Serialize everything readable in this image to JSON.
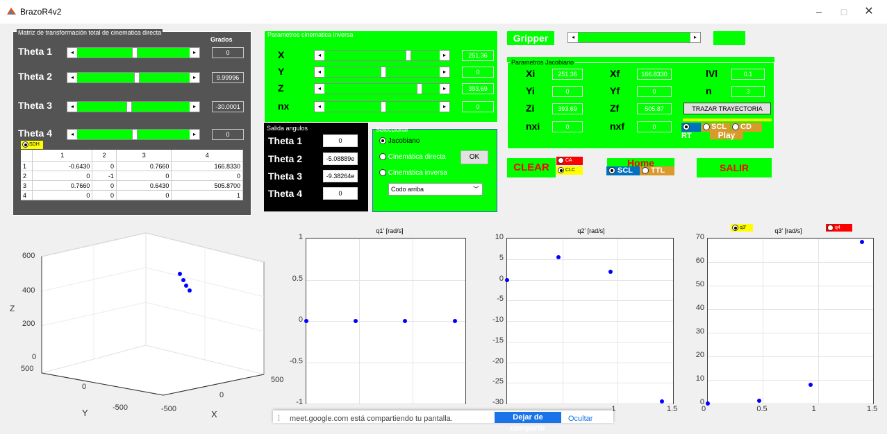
{
  "window": {
    "title": "BrazoR4v2",
    "minimize": "–",
    "maximize": "□",
    "close": "✕"
  },
  "direct": {
    "panel_title": "Matriz de transformación total de cinematica directa",
    "grados_label": "Grados",
    "thetas": [
      {
        "label": "Theta 1",
        "value": "0",
        "level": 0.5
      },
      {
        "label": "Theta 2",
        "value": "9.99996",
        "level": 0.52
      },
      {
        "label": "Theta 3",
        "value": "-30.0001",
        "level": 0.45
      },
      {
        "label": "Theta 4",
        "value": "0",
        "level": 0.5
      }
    ],
    "sdh_label": "SDH",
    "matrix_headers": [
      "1",
      "2",
      "3",
      "4"
    ],
    "matrix_rows": [
      {
        "idx": "1",
        "c": [
          "-0.6430",
          "0",
          "0.7660",
          "166.8330"
        ]
      },
      {
        "idx": "2",
        "c": [
          "0",
          "-1",
          "0",
          "0"
        ]
      },
      {
        "idx": "3",
        "c": [
          "0.7660",
          "0",
          "0.6430",
          "505.8700"
        ]
      },
      {
        "idx": "4",
        "c": [
          "0",
          "0",
          "0",
          "1"
        ]
      }
    ]
  },
  "inverse": {
    "panel_title": "Parametros cinematica inversa",
    "params": [
      {
        "label": "X",
        "value": "251.36",
        "level": 0.72
      },
      {
        "label": "Y",
        "value": "0",
        "level": 0.5
      },
      {
        "label": "Z",
        "value": "393.69",
        "level": 0.82
      },
      {
        "label": "nx",
        "value": "0",
        "level": 0.5
      }
    ]
  },
  "salida": {
    "panel_title": "Salida angulos",
    "rows": [
      {
        "label": "Theta 1",
        "value": "0"
      },
      {
        "label": "Theta 2",
        "value": "-5.08889e"
      },
      {
        "label": "Theta 3",
        "value": "-9.38264e"
      },
      {
        "label": "Theta 4",
        "value": "0"
      }
    ]
  },
  "seleccionar": {
    "panel_title": "Seleccionar",
    "options": [
      "Jacobiano",
      "Cinemática directa",
      "Cinemática inversa"
    ],
    "ok_label": "OK",
    "dropdown_value": "Codo arriba"
  },
  "gripper": {
    "label": "Gripper",
    "level": 0.95
  },
  "jacobiano": {
    "panel_title": "Parametros Jacobiano",
    "left": [
      {
        "label": "Xi",
        "value": "251.36"
      },
      {
        "label": "Yi",
        "value": "0"
      },
      {
        "label": "Zi",
        "value": "393.69"
      },
      {
        "label": "nxi",
        "value": "0"
      }
    ],
    "mid": [
      {
        "label": "Xf",
        "value": "166.8330"
      },
      {
        "label": "Yf",
        "value": "0"
      },
      {
        "label": "Zf",
        "value": "505.87"
      },
      {
        "label": "nxf",
        "value": "0"
      }
    ],
    "right": [
      {
        "label": "lVl",
        "value": "0.1"
      },
      {
        "label": "n",
        "value": "3"
      }
    ],
    "trazar_label": "TRAZAR TRAYECTORIA",
    "modes": [
      "RT",
      "SCL",
      "CD"
    ],
    "play_label": "Play"
  },
  "controls": {
    "clear_label": "CLEAR",
    "ca_label": "CA",
    "clc_label": "CLC",
    "home_label": "Home",
    "home_modes": [
      "SCL",
      "TTL"
    ],
    "salir_label": "SALIR"
  },
  "plot3d": {
    "zlabel": "Z",
    "ylabel": "Y",
    "xlabel": "X",
    "zticks": [
      "600",
      "400",
      "200",
      "0"
    ],
    "yticks": [
      "500",
      "0",
      "-500"
    ],
    "xticks": [
      "-500",
      "0",
      "500"
    ]
  },
  "chart_data": [
    {
      "type": "scatter",
      "title": "q1'  [rad/s]",
      "x": [
        0,
        0.4667,
        0.9333,
        1.4
      ],
      "y": [
        0,
        0,
        0,
        0
      ],
      "xlim": [
        0,
        1.5
      ],
      "ylim": [
        -1,
        1
      ],
      "yticks": [
        "1",
        "0.5",
        "0",
        "-0.5",
        "-1"
      ],
      "grid": true
    },
    {
      "type": "scatter",
      "title": "q2'  [rad/s]",
      "x": [
        0,
        0.4667,
        0.9333,
        1.4
      ],
      "y": [
        0,
        5.4,
        1.9,
        -29.5
      ],
      "xlim": [
        0,
        1.5
      ],
      "ylim": [
        -30,
        10
      ],
      "yticks": [
        "10",
        "5",
        "0",
        "-5",
        "-10",
        "-15",
        "-20",
        "-25",
        "-30"
      ],
      "xticks": [
        "1",
        "1.5"
      ],
      "grid": true
    },
    {
      "type": "scatter",
      "title": "q3'  [rad/s]",
      "x": [
        0,
        0.4667,
        0.9333,
        1.4
      ],
      "y": [
        0,
        1.3,
        7.9,
        68.5
      ],
      "xlim": [
        0,
        1.5
      ],
      "ylim": [
        0,
        70
      ],
      "yticks": [
        "70",
        "60",
        "50",
        "40",
        "30",
        "20",
        "10",
        "0"
      ],
      "xticks": [
        "0",
        "0.5",
        "1",
        "1.5"
      ],
      "grid": true,
      "q3_radio": "q3'",
      "q4_radio": "q4"
    }
  ],
  "share_bar": {
    "message": "meet.google.com está compartiendo tu pantalla.",
    "stop_label": "Dejar de compartir",
    "hide_label": "Ocultar"
  }
}
